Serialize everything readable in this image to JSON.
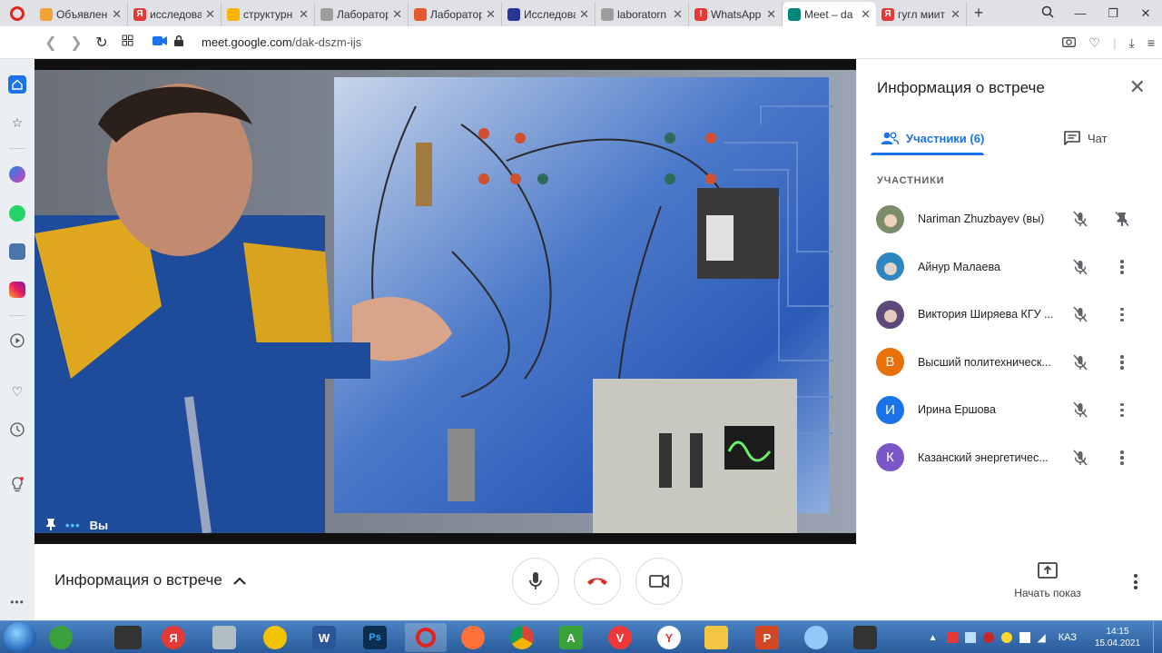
{
  "browser": {
    "tabs": [
      {
        "title": "Объявления",
        "color": "#f2a33a",
        "glyph": ""
      },
      {
        "title": "исследова",
        "color": "#e53935",
        "glyph": "Я"
      },
      {
        "title": "структурн",
        "color": "#f9b200",
        "glyph": ""
      },
      {
        "title": "Лаборатор",
        "color": "#9e9e9e",
        "glyph": ""
      },
      {
        "title": "Лаборатор",
        "color": "#e65a2e",
        "glyph": ""
      },
      {
        "title": "Исследова",
        "color": "#283593",
        "glyph": ""
      },
      {
        "title": "laboratorn",
        "color": "#9e9e9e",
        "glyph": ""
      },
      {
        "title": "WhatsApp",
        "color": "#e53935",
        "glyph": "!"
      },
      {
        "title": "Meet – da",
        "color": "#00897b",
        "glyph": ""
      },
      {
        "title": "гугл миит",
        "color": "#e53935",
        "glyph": "Я"
      }
    ],
    "active_tab": 8,
    "url_host": "meet.google.com",
    "url_path": "/dak-dszm-ijs"
  },
  "video": {
    "self_label": "Вы"
  },
  "panel": {
    "title": "Информация о встрече",
    "tab_people": "Участники (6)",
    "tab_chat": "Чат",
    "section_label": "УЧАСТНИКИ",
    "participants": [
      {
        "name": "Nariman Zhuzbayev (вы)",
        "initial": "",
        "color": "#7a8c6a"
      },
      {
        "name": "Айнур Малаева",
        "initial": "",
        "color": "#2e86c1"
      },
      {
        "name": "Виктория Ширяева КГУ ...",
        "initial": "",
        "color": "#5d4a7a"
      },
      {
        "name": "Высший политехническ...",
        "initial": "В",
        "color": "#e8710a"
      },
      {
        "name": "Ирина Ершова",
        "initial": "И",
        "color": "#1a73e8"
      },
      {
        "name": "Казанский энергетичес...",
        "initial": "К",
        "color": "#7b56c8"
      }
    ]
  },
  "bottombar": {
    "meeting_info": "Информация о встрече",
    "present_label": "Начать показ"
  },
  "taskbar": {
    "language": "КАЗ",
    "time": "14:15",
    "date": "15.04.2021"
  }
}
